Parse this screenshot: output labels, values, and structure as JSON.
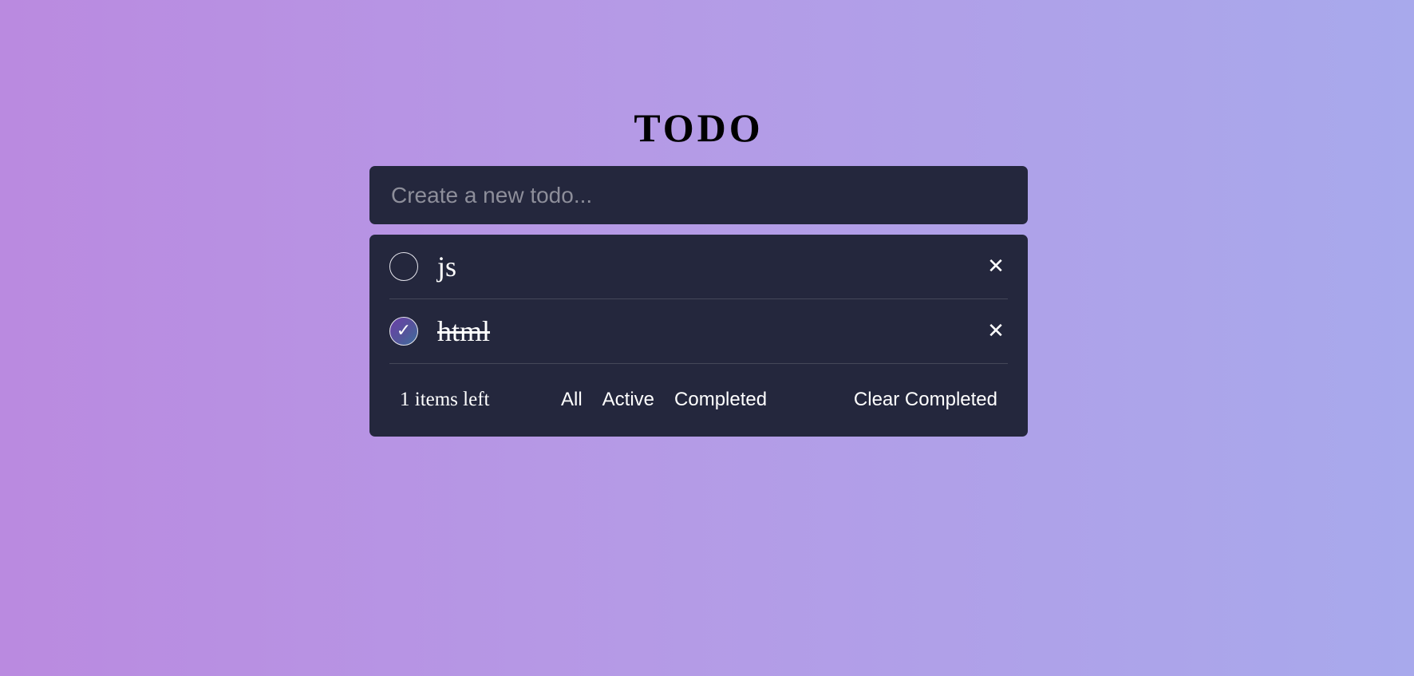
{
  "app": {
    "title": "TODO"
  },
  "new_todo": {
    "placeholder": "Create a new todo...",
    "value": ""
  },
  "todos": [
    {
      "text": "js",
      "completed": false,
      "delete_icon": "✕"
    },
    {
      "text": "html",
      "completed": true,
      "check_icon": "✓",
      "delete_icon": "✕"
    }
  ],
  "footer": {
    "items_left": "1 items left",
    "filters": [
      "All",
      "Active",
      "Completed"
    ],
    "clear_label": "Clear Completed"
  },
  "colors": {
    "panel": "#24273d",
    "gradient_left": "#ba8ae0",
    "gradient_right": "#a8a9ec",
    "check_gradient_start": "#6b3fa8",
    "check_gradient_end": "#3d6f9c"
  },
  "icons": {
    "delete": "close-icon",
    "check": "checkmark-icon"
  }
}
